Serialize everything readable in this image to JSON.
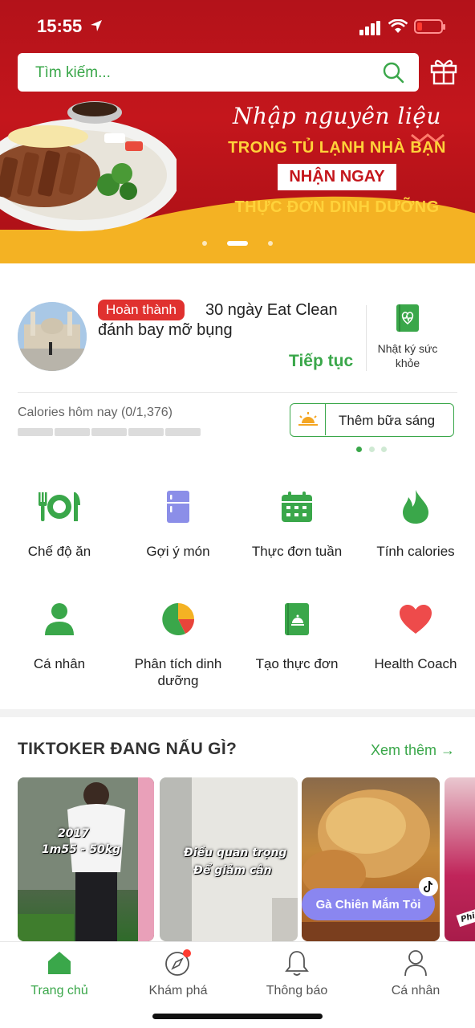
{
  "status_bar": {
    "time": "15:55"
  },
  "search": {
    "placeholder": "Tìm kiếm..."
  },
  "banner": {
    "line1": "Nhập nguyên liệu",
    "line2": "TRONG TỦ LẠNH NHÀ BẠN",
    "line3": "NHẬN NGAY",
    "line4": "THỰC ĐƠN DINH DƯỠNG",
    "active_slide": 2,
    "slide_count": 3
  },
  "program": {
    "badge": "Hoàn thành",
    "title": "30 ngày Eat Clean đánh bay mỡ bụng",
    "continue_label": "Tiếp tục",
    "diary_label": "Nhật ký sức khỏe"
  },
  "calories": {
    "label": "Calories hôm nay (0/1,376)",
    "consumed": 0,
    "goal": 1376,
    "add_meal_label": "Thêm bữa sáng",
    "page_dots": 3,
    "active_dot": 1
  },
  "features": [
    {
      "label": "Chế độ ăn",
      "icon": "plate-cutlery-icon"
    },
    {
      "label": "Gợi ý món",
      "icon": "fridge-icon"
    },
    {
      "label": "Thực đơn tuần",
      "icon": "calendar-icon"
    },
    {
      "label": "Tính calories",
      "icon": "flame-icon"
    },
    {
      "label": "Cá nhân",
      "icon": "person-icon"
    },
    {
      "label": "Phân tích dinh dưỡng",
      "icon": "pie-chart-icon"
    },
    {
      "label": "Tạo thực đơn",
      "icon": "menu-book-icon"
    },
    {
      "label": "Health Coach",
      "icon": "heart-icon"
    }
  ],
  "tiktok": {
    "title": "TIKTOKER ĐANG NẤU GÌ?",
    "more": "Xem thêm →",
    "videos": [
      {
        "caption1": "2017",
        "caption2": "1m55 - 50kg"
      },
      {
        "caption1": "Điều quan trọng",
        "caption2": "Để giảm cân"
      },
      {
        "pill": "Gà Chiên Mắm Tỏi"
      },
      {
        "caption1": "Phi L"
      }
    ]
  },
  "nav": [
    {
      "label": "Trang chủ",
      "icon": "home-icon",
      "active": true
    },
    {
      "label": "Khám phá",
      "icon": "compass-icon",
      "active": false
    },
    {
      "label": "Thông báo",
      "icon": "bell-icon",
      "active": false
    },
    {
      "label": "Cá nhân",
      "icon": "user-icon",
      "active": false
    }
  ],
  "colors": {
    "brand_green": "#3aa74a",
    "banner_red": "#c4161c",
    "badge_red": "#e0312f",
    "banner_yellow": "#f4b223"
  }
}
